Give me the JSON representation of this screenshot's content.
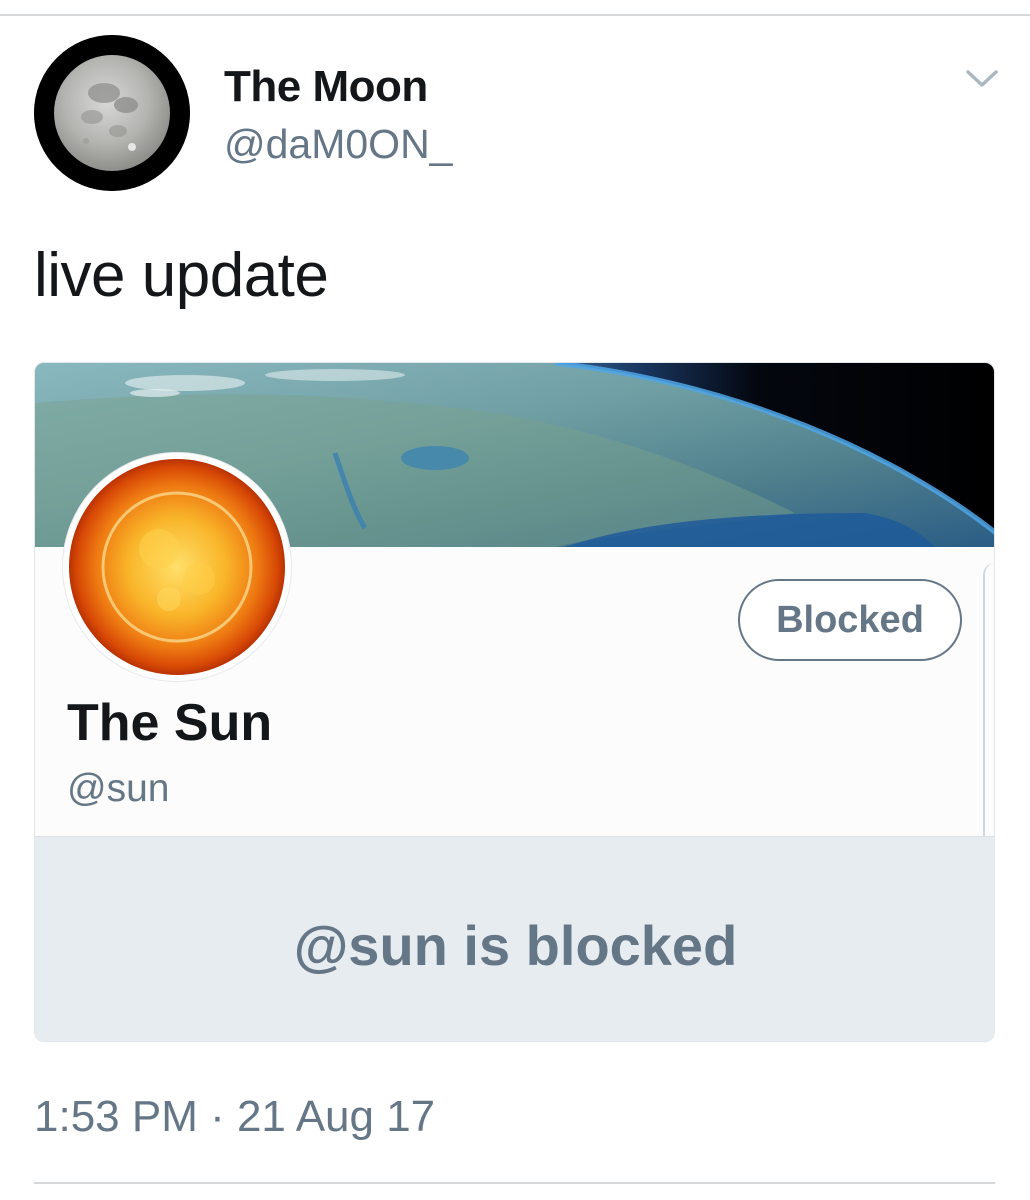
{
  "tweet": {
    "author": {
      "name": "The Moon",
      "handle": "@daM0ON_",
      "avatar_icon": "moon-avatar-icon"
    },
    "menu_icon": "chevron-down-icon",
    "text": "live update",
    "timestamp": "1:53 PM · 21 Aug 17"
  },
  "embedded_profile": {
    "banner_image": "earth-from-space-banner",
    "avatar_icon": "sun-avatar-icon",
    "name": "The Sun",
    "handle": "@sun",
    "button_label": "Blocked",
    "blocked_notice": "@sun is blocked"
  },
  "colors": {
    "primary_text": "#14171a",
    "secondary_text": "#657786",
    "notice_background": "#e6ecf0",
    "border": "#e1e8ed"
  }
}
